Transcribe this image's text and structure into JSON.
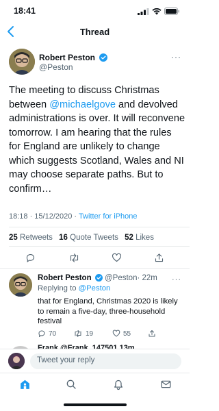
{
  "status_bar": {
    "time": "18:41"
  },
  "header": {
    "title": "Thread"
  },
  "main_tweet": {
    "author_name": "Robert Peston",
    "author_handle": "@Peston",
    "text_before": "The meeting to discuss Christmas between ",
    "mention": "@michaelgove",
    "text_after": " and devolved administrations is over. It will reconvene tomorrow. I am hearing that the rules for England are unlikely to change which suggests Scotland, Wales and NI may choose separate paths. But to confirm…",
    "timestamp": "18:18 · 15/12/2020",
    "separator": " · ",
    "source": "Twitter for iPhone",
    "retweets_count": "25",
    "retweets_label": "Retweets",
    "quote_count": "16",
    "quote_label": "Quote Tweets",
    "likes_count": "52",
    "likes_label": "Likes",
    "more": "···"
  },
  "reply_tweet": {
    "author_name": "Robert Peston",
    "author_handle": "@Peston",
    "time": "· 22m",
    "replying_prefix": "Replying to ",
    "replying_to": "@Peston",
    "text": "that for England, Christmas 2020 is likely to remain a five-day, three-household festival",
    "reply_count": "70",
    "retweet_count": "19",
    "like_count": "55",
    "more": "···"
  },
  "next_tweet_peek": {
    "text": "Frank  @Frank_147501  13m"
  },
  "compose": {
    "placeholder": "Tweet your reply"
  },
  "colors": {
    "accent": "#1d9bf0",
    "text": "#0f1419",
    "secondary": "#536471"
  },
  "icons": [
    "back-chevron-icon",
    "verified-icon",
    "reply-icon",
    "retweet-icon",
    "like-icon",
    "share-icon",
    "home-icon",
    "search-icon",
    "notifications-icon",
    "messages-icon"
  ]
}
